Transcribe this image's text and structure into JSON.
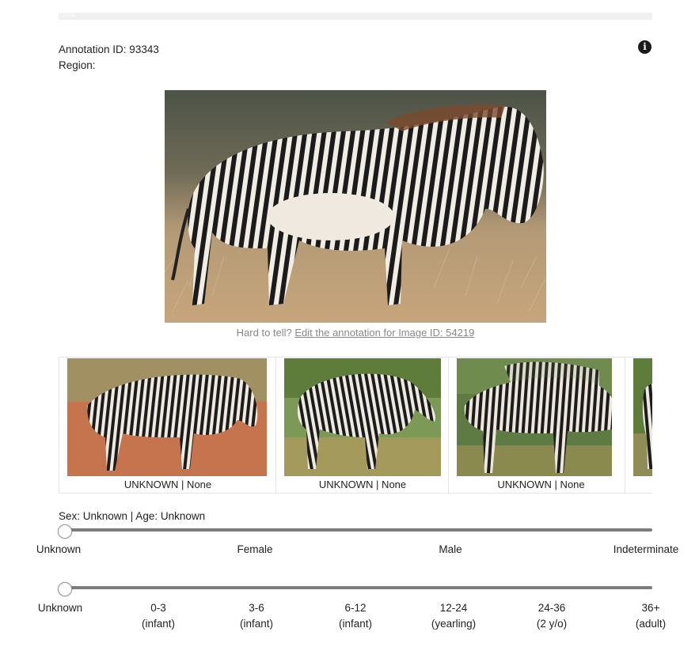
{
  "header": {
    "progress_text": "Done",
    "progress_fraction": 0
  },
  "annotation": {
    "id_text": "Annotation ID: 93343",
    "region_text": "Region:"
  },
  "icons": {
    "info": "info-icon"
  },
  "hint": {
    "prefix": "Hard to tell? ",
    "link": "Edit the annotation for Image ID: 54219"
  },
  "candidates": [
    {
      "label": "UNKNOWN | None"
    },
    {
      "label": "UNKNOWN | None"
    },
    {
      "label": "UNKNOWN | None"
    },
    {
      "label": ""
    }
  ],
  "status": {
    "sex_age": "Sex: Unknown | Age: Unknown"
  },
  "sex_slider": {
    "ticks": [
      "Unknown",
      "Female",
      "Male",
      "Indeterminate"
    ],
    "selected_index": 0
  },
  "age_slider": {
    "ticks": [
      {
        "line1": "Unknown",
        "line2": ""
      },
      {
        "line1": "0-3",
        "line2": "(infant)"
      },
      {
        "line1": "3-6",
        "line2": "(infant)"
      },
      {
        "line1": "6-12",
        "line2": "(infant)"
      },
      {
        "line1": "12-24",
        "line2": "(yearling)"
      },
      {
        "line1": "24-36",
        "line2": "(2 y/o)"
      },
      {
        "line1": "36+",
        "line2": "(adult)"
      }
    ],
    "selected_index": 0
  },
  "colors": {
    "link": "#888888",
    "track": "#7c7c7c"
  }
}
